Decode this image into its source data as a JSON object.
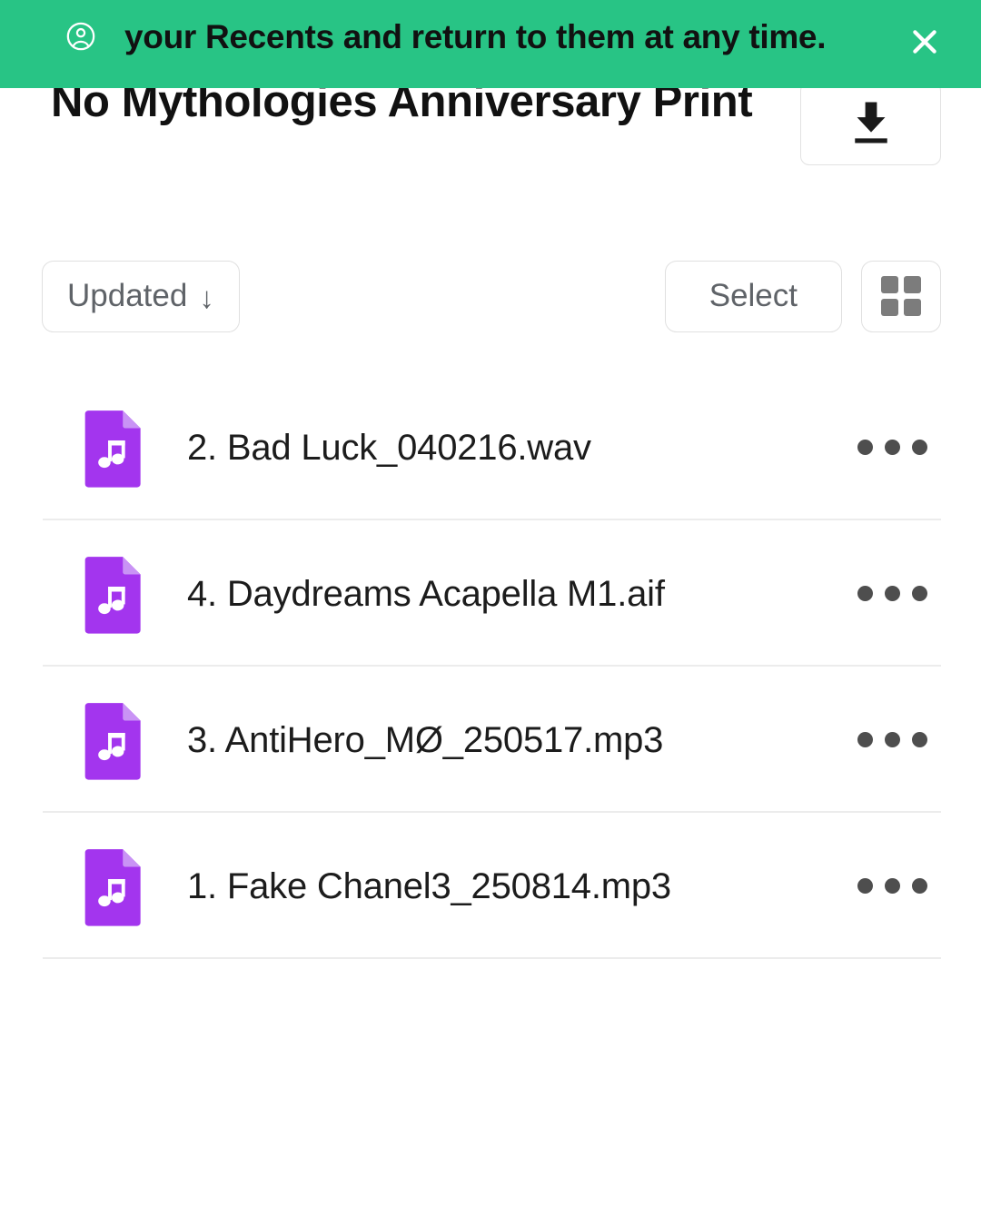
{
  "banner": {
    "icon": "account-circle-icon",
    "message": "your Recents and return to them at any time.",
    "close_label": "×",
    "background_color": "#28c485",
    "text_color": "#111111"
  },
  "header": {
    "title": "No Mythologies Anniversary Print",
    "download_icon": "download-icon"
  },
  "toolbar": {
    "sort_label": "Updated",
    "sort_arrow": "↓",
    "select_label": "Select",
    "grid_view_icon": "grid-view-icon"
  },
  "files": {
    "icon_color": "#a335ee",
    "more_icon": "more-horizontal-icon",
    "items": [
      {
        "name": "2. Bad Luck_040216.wav",
        "icon": "audio-file-icon"
      },
      {
        "name": "4. Daydreams Acapella M1.aif",
        "icon": "audio-file-icon"
      },
      {
        "name": "3. AntiHero_MØ_250517.mp3",
        "icon": "audio-file-icon"
      },
      {
        "name": "1. Fake Chanel3_250814.mp3",
        "icon": "audio-file-icon"
      }
    ]
  }
}
